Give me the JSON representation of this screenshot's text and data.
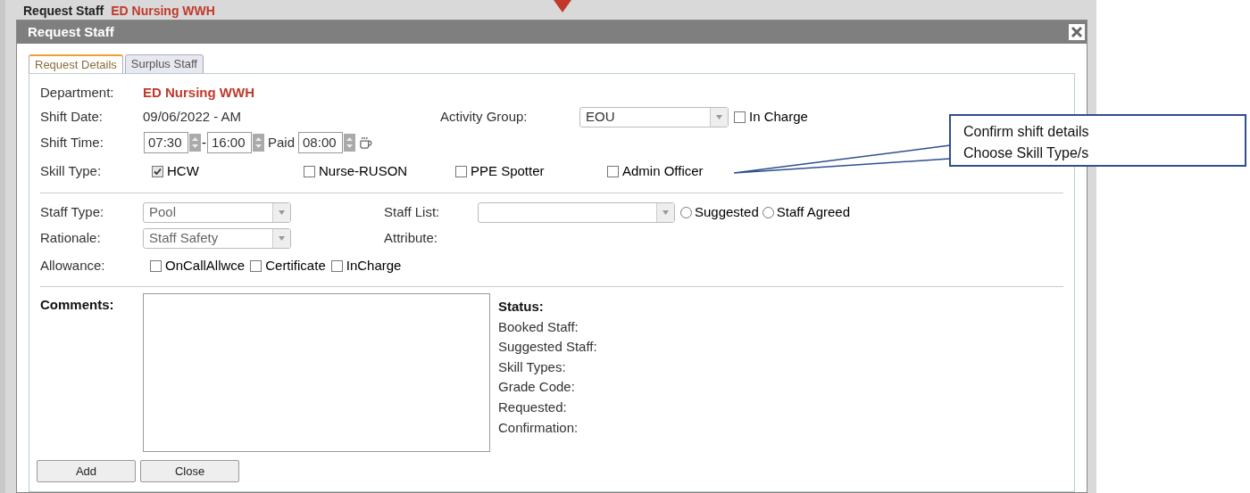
{
  "background": {
    "title": "Request Staff",
    "department": "ED Nursing WWH"
  },
  "dialog": {
    "title": "Request Staff",
    "tabs": [
      {
        "label": "Request Details",
        "selected": true
      },
      {
        "label": "Surplus Staff",
        "selected": false
      }
    ],
    "department": {
      "label": "Department:",
      "value": "ED Nursing WWH"
    },
    "shift_date": {
      "label": "Shift Date:",
      "value": "09/06/2022 - AM"
    },
    "activity_group": {
      "label": "Activity Group:",
      "value": "EOU"
    },
    "in_charge": {
      "label": "In Charge",
      "checked": false
    },
    "shift_time": {
      "label": "Shift Time:",
      "start": "07:30",
      "separator": "-",
      "end": "16:00",
      "paid_label": "Paid",
      "paid": "08:00"
    },
    "skill_type": {
      "label": "Skill Type:",
      "options": [
        {
          "label": "HCW",
          "checked": true
        },
        {
          "label": "Nurse-RUSON",
          "checked": false
        },
        {
          "label": "PPE Spotter",
          "checked": false
        },
        {
          "label": "Admin Officer",
          "checked": false
        }
      ]
    },
    "staff_type": {
      "label": "Staff Type:",
      "value": "Pool"
    },
    "staff_list": {
      "label": "Staff List:"
    },
    "staff_list_options": [
      {
        "label": "Suggested",
        "selected": false
      },
      {
        "label": "Staff Agreed",
        "selected": false
      }
    ],
    "rationale": {
      "label": "Rationale:",
      "value": "Staff Safety"
    },
    "attribute": {
      "label": "Attribute:"
    },
    "allowance": {
      "label": "Allowance:",
      "options": [
        {
          "label": "OnCallAllwce",
          "checked": false
        },
        {
          "label": "Certificate",
          "checked": false
        },
        {
          "label": "InCharge",
          "checked": false
        }
      ]
    },
    "comments": {
      "label": "Comments:"
    },
    "status": {
      "title": "Status:",
      "items": [
        "Booked Staff:",
        "Suggested Staff:",
        "Skill Types:",
        "Grade Code:",
        "Requested:",
        "Confirmation:"
      ]
    },
    "buttons": [
      "Add",
      "Close"
    ]
  },
  "callout": {
    "lines": [
      "Confirm shift details",
      "Choose Skill Type/s"
    ]
  }
}
